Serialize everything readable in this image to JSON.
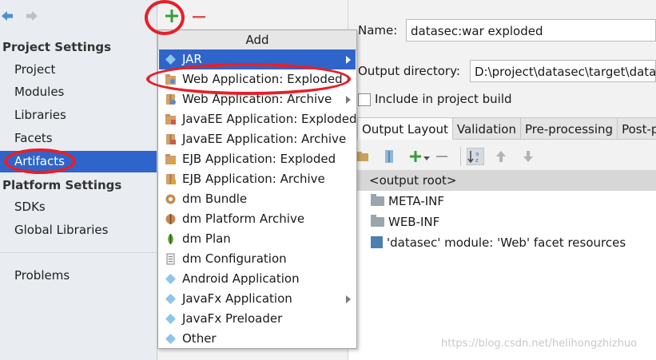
{
  "sidebar": {
    "project_settings_header": "Project Settings",
    "project_items": [
      {
        "label": "Project"
      },
      {
        "label": "Modules"
      },
      {
        "label": "Libraries"
      },
      {
        "label": "Facets"
      },
      {
        "label": "Artifacts",
        "selected": true
      }
    ],
    "platform_settings_header": "Platform Settings",
    "platform_items": [
      {
        "label": "SDKs"
      },
      {
        "label": "Global Libraries"
      }
    ],
    "problems_label": "Problems"
  },
  "toolbar": {
    "add_icon": "plus-icon",
    "remove_icon": "minus-icon"
  },
  "popup": {
    "title": "Add",
    "items": [
      {
        "label": "JAR",
        "icon": "jar-icon",
        "submenu": true
      },
      {
        "label": "Web Application: Exploded",
        "icon": "web-app-icon",
        "submenu": false
      },
      {
        "label": "Web Application: Archive",
        "icon": "web-archive-icon",
        "submenu": true
      },
      {
        "label": "JavaEE Application: Exploded",
        "icon": "javaee-icon",
        "submenu": false
      },
      {
        "label": "JavaEE Application: Archive",
        "icon": "javaee-archive-icon",
        "submenu": false
      },
      {
        "label": "EJB Application: Exploded",
        "icon": "ejb-icon",
        "submenu": false
      },
      {
        "label": "EJB Application: Archive",
        "icon": "ejb-archive-icon",
        "submenu": false
      },
      {
        "label": "dm Bundle",
        "icon": "bundle-icon",
        "submenu": false
      },
      {
        "label": "dm Platform Archive",
        "icon": "platform-archive-icon",
        "submenu": false
      },
      {
        "label": "dm Plan",
        "icon": "plan-icon",
        "submenu": false
      },
      {
        "label": "dm Configuration",
        "icon": "config-file-icon",
        "submenu": false
      },
      {
        "label": "Android Application",
        "icon": "android-icon",
        "submenu": false
      },
      {
        "label": "JavaFx Application",
        "icon": "javafx-icon",
        "submenu": true
      },
      {
        "label": "JavaFx Preloader",
        "icon": "javafx-preloader-icon",
        "submenu": false
      },
      {
        "label": "Other",
        "icon": "other-icon",
        "submenu": false
      }
    ]
  },
  "artifact": {
    "name_label": "Name:",
    "name_value": "datasec:war exploded",
    "output_dir_label": "Output directory:",
    "output_dir_value": "D:\\project\\datasec\\target\\datas",
    "include_build_label": "Include in project build",
    "tabs": [
      {
        "label": "Output Layout",
        "active": true
      },
      {
        "label": "Validation"
      },
      {
        "label": "Pre-processing"
      },
      {
        "label": "Post-pr"
      }
    ],
    "tree": [
      {
        "label": "<output root>",
        "selected": true
      },
      {
        "label": "META-INF"
      },
      {
        "label": "WEB-INF"
      },
      {
        "label": "'datasec' module: 'Web' facet resources"
      }
    ]
  },
  "watermark": "https://blog.csdn.net/helihongzhizhuo",
  "colors": {
    "selection": "#2f65ca",
    "annotation": "#e5202a",
    "add_green": "#3c9b3c",
    "remove_red": "#d9534f"
  }
}
